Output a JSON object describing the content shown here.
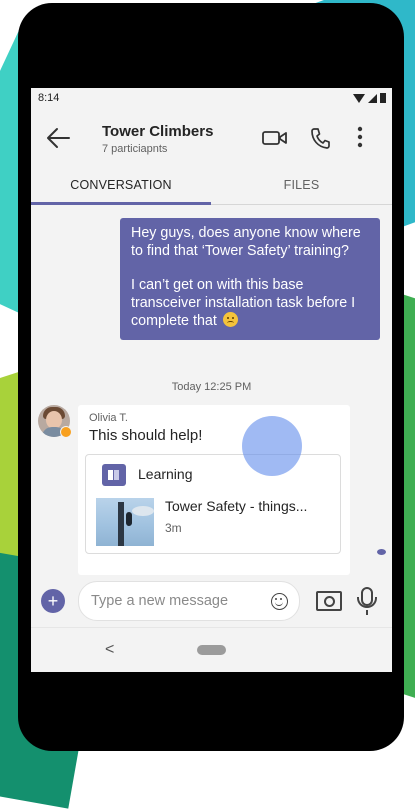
{
  "status_bar": {
    "time": "8:14"
  },
  "header": {
    "title": "Tower Climbers",
    "subtitle": "7 particiapnts"
  },
  "tabs": [
    {
      "label": "CONVERSATION",
      "selected": true
    },
    {
      "label": "FILES",
      "selected": false
    }
  ],
  "messages": {
    "outgoing": {
      "paragraph1": "Hey guys, does anyone know where to find that ‘Tower Safety’ training?",
      "paragraph2": "I can’t get on with this base transceiver installation task before I complete that"
    },
    "timestamp": "Today 12:25 PM",
    "incoming": {
      "sender": "Olivia T.",
      "text": "This should help!",
      "card": {
        "app_label": "Learning",
        "title": "Tower Safety - things...",
        "duration": "3m"
      }
    }
  },
  "composer": {
    "placeholder": "Type a new message"
  },
  "colors": {
    "accent": "#6264a7",
    "presence": "#f8a01f"
  },
  "icons": [
    "back-arrow-icon",
    "video-call-icon",
    "phone-call-icon",
    "more-options-icon",
    "learning-icon",
    "add-icon",
    "emoji-icon",
    "camera-icon",
    "microphone-icon",
    "seen-icon"
  ]
}
